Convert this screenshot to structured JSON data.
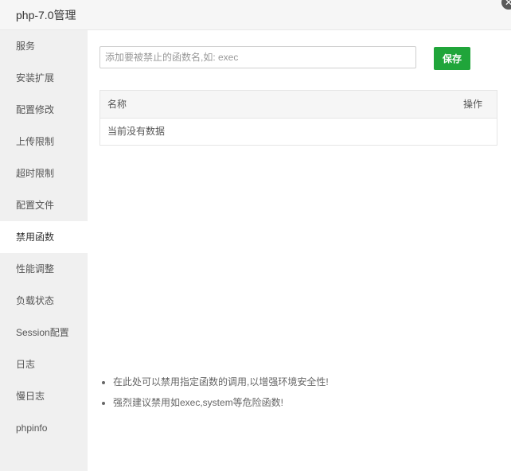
{
  "window": {
    "title": "php-7.0管理",
    "close_glyph": "✕"
  },
  "sidebar": {
    "items": [
      {
        "label": "服务"
      },
      {
        "label": "安装扩展"
      },
      {
        "label": "配置修改"
      },
      {
        "label": "上传限制"
      },
      {
        "label": "超时限制"
      },
      {
        "label": "配置文件"
      },
      {
        "label": "禁用函数",
        "active": true
      },
      {
        "label": "性能调整"
      },
      {
        "label": "负载状态"
      },
      {
        "label": "Session配置"
      },
      {
        "label": "日志"
      },
      {
        "label": "慢日志"
      },
      {
        "label": "phpinfo"
      }
    ]
  },
  "main": {
    "input": {
      "placeholder": "添加要被禁止的函数名,如: exec",
      "value": ""
    },
    "save_label": "保存",
    "table": {
      "columns": [
        "名称",
        "操作"
      ],
      "empty_text": "当前没有数据"
    },
    "tips": [
      "在此处可以禁用指定函数的调用,以增强环境安全性!",
      "强烈建议禁用如exec,system等危险函数!"
    ]
  },
  "colors": {
    "accent": "#20a53a",
    "sidebar_bg": "#f0f0f0",
    "titlebar_bg": "#f6f6f6"
  }
}
